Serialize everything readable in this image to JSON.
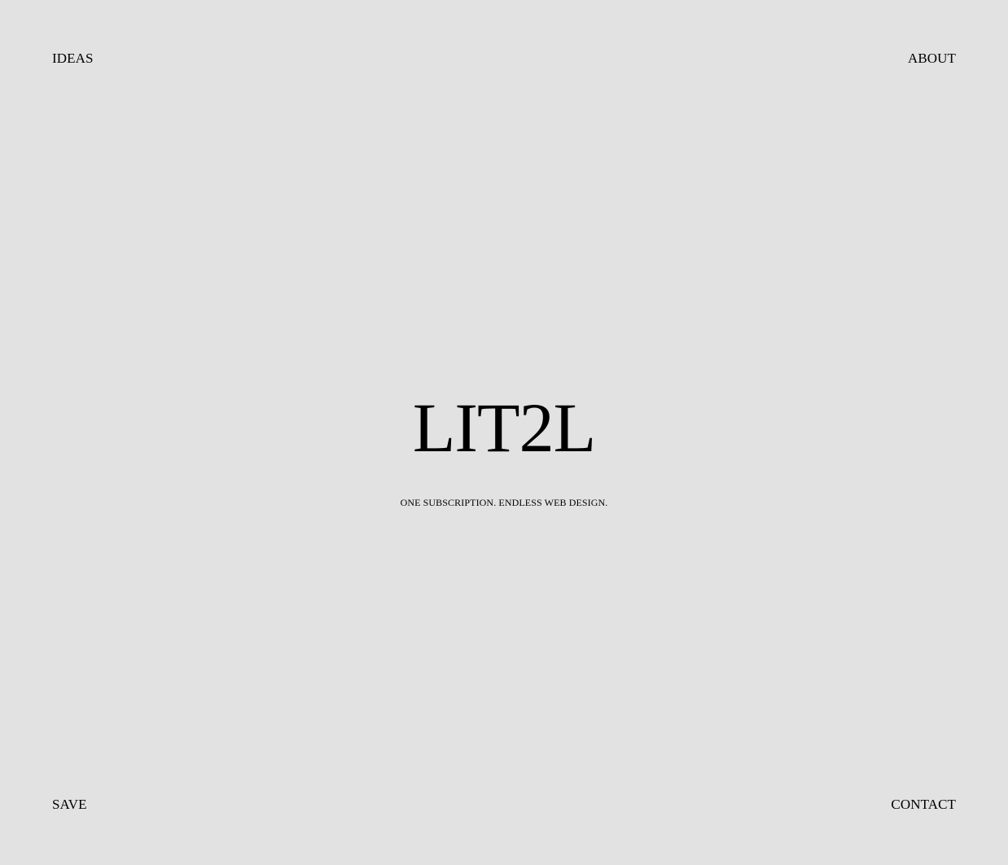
{
  "nav": {
    "top_left": "IDEAS",
    "top_right": "ABOUT",
    "bottom_left": "SAVE",
    "bottom_right": "CONTACT"
  },
  "hero": {
    "brand": "LIT2L",
    "tagline": "ONE SUBSCRIPTION. ENDLESS WEB DESIGN."
  },
  "colors": {
    "background": "#e2e2e2",
    "text": "#000000"
  }
}
